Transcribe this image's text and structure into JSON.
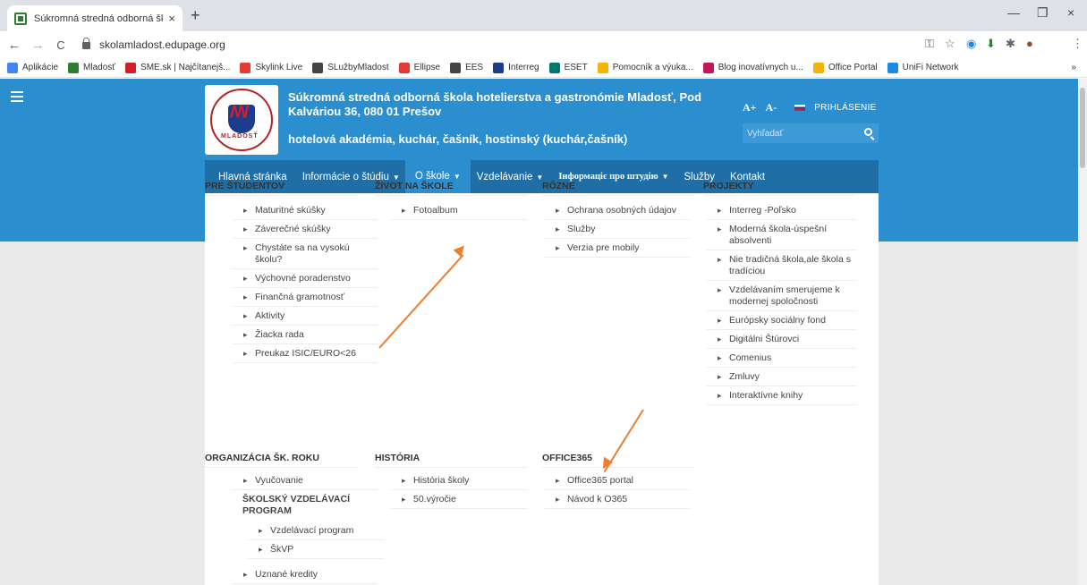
{
  "browser": {
    "tab_title": "Súkromná stredná odborná škola",
    "tab_close": "×",
    "new_tab": "+",
    "url": "skolamladost.edupage.org",
    "back": "←",
    "forward": "→",
    "reload": "C",
    "minimize": "—",
    "restore": "❐",
    "close": "×",
    "bookmarks": [
      {
        "label": "Aplikácie",
        "color": "#4285f4"
      },
      {
        "label": "Mladosť",
        "color": "#2f7d32"
      },
      {
        "label": "SME.sk | Najčítanejš...",
        "color": "#d21f2b"
      },
      {
        "label": "Skylink Live",
        "color": "#e53935"
      },
      {
        "label": "SLužbyMladost",
        "color": "#444444"
      },
      {
        "label": "Ellipse",
        "color": "#e53935"
      },
      {
        "label": "EES",
        "color": "#444444"
      },
      {
        "label": "Interreg",
        "color": "#1c3c8c"
      },
      {
        "label": "ESET",
        "color": "#00796b"
      },
      {
        "label": "Pomocník a výuka...",
        "color": "#f4b400"
      },
      {
        "label": "Blog inovatívnych u...",
        "color": "#c2185b"
      },
      {
        "label": "Office Portal",
        "color": "#f4b400"
      },
      {
        "label": "UniFi Network",
        "color": "#1e88e5"
      }
    ],
    "bookmarks_more": "»"
  },
  "header": {
    "school_name": "Súkromná stredná odborná škola hotelierstva a gastronómie Mladosť, Pod Kalváriou 36, 080 01 Prešov",
    "tagline": "hotelová akadémia, kuchár, čašník, hostinský (kuchár,čašník)",
    "logo_text": "MLADOSŤ",
    "font_plus": "A+",
    "font_minus": "A-",
    "login": "PRIHLÁSENIE",
    "search_placeholder": "Vyhľadať"
  },
  "nav": [
    {
      "label": "Hlavná stránka",
      "caret": ""
    },
    {
      "label": "Informácie o štúdiu",
      "caret": "▼"
    },
    {
      "label": "O škole",
      "caret": "▼"
    },
    {
      "label": "Vzdelávanie",
      "caret": "▼"
    },
    {
      "label": "Інформаціє про штудію",
      "caret": "▼"
    },
    {
      "label": "Služby",
      "caret": ""
    },
    {
      "label": "Kontakt",
      "caret": ""
    }
  ],
  "menu": {
    "pre_studentov": {
      "title": "PRE ŠTUDENTOV",
      "items": [
        "Maturitné skúšky",
        "Záverečné skúšky",
        "Chystáte sa na vysokú školu?",
        "Výchovné poradenstvo",
        "Finančná gramotnosť",
        "Aktivity",
        "Žiacka rada",
        "Preukaz ISIC/EURO<26"
      ]
    },
    "zivot_na_skole": {
      "title": "ŽIVOT NA ŠKOLE",
      "items": [
        "Fotoalbum"
      ]
    },
    "rozne": {
      "title": "RÔZNE",
      "items": [
        "Ochrana osobných údajov",
        "Služby",
        "Verzia pre mobily"
      ]
    },
    "projekty": {
      "title": "PROJEKTY",
      "items": [
        "Interreg -Poľsko",
        "Moderná škola-úspešní absolventi",
        "Nie tradičná škola,ale škola s tradíciou",
        "Vzdelávaním smerujeme k modernej spoločnosti",
        "Európsky sociálny fond",
        "Digitálni Štúrovci",
        "Comenius",
        "Zmluvy",
        "Interaktívne knihy"
      ]
    },
    "organizacia": {
      "title": "ORGANIZÁCIA ŠK. ROKU",
      "items": [
        "Vyučovanie"
      ],
      "subhead": "ŠKOLSKÝ VZDELÁVACÍ PROGRAM",
      "sub_items": [
        "Vzdelávací program",
        "ŠkVP"
      ],
      "extra_items": [
        "Uznané kredity"
      ]
    },
    "historia": {
      "title": "HISTÓRIA",
      "items": [
        "História školy",
        "50.výročie"
      ]
    },
    "office365": {
      "title": "OFFICE365",
      "items": [
        "Office365 portal",
        "Návod k O365"
      ]
    }
  },
  "colors": {
    "header_blue": "#2b8ecf",
    "nav_blue": "#1f6fa6",
    "arrow_orange": "#ed7d31"
  }
}
